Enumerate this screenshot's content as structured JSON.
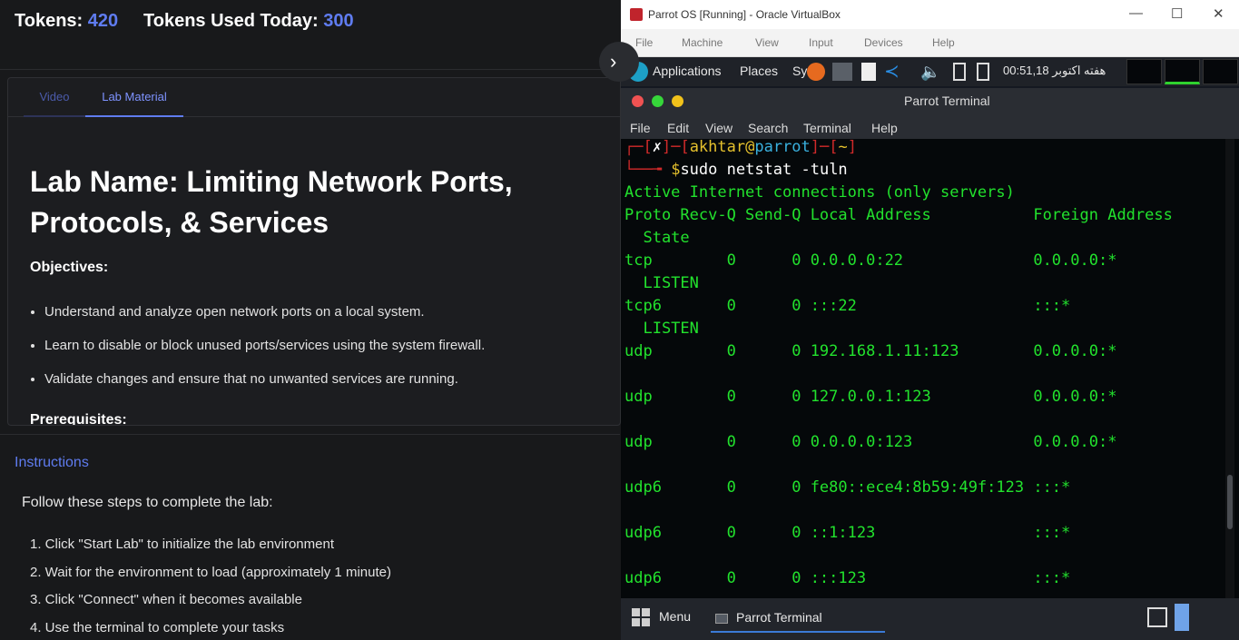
{
  "lab": {
    "tokens_label": "Tokens:",
    "tokens_value": "420",
    "tokens_today_label": "Tokens Used Today:",
    "tokens_today_value": "300",
    "tabs": [
      {
        "label": "Video"
      },
      {
        "label": "Lab Material"
      }
    ],
    "title": "Lab Name: Limiting Network Ports, Protocols, & Services",
    "objectives_heading": "Objectives:",
    "objectives": [
      "Understand and analyze open network ports on a local system.",
      "Learn to disable or block unused ports/services using the system firewall.",
      "Validate changes and ensure that no unwanted services are running."
    ],
    "prerequisites_heading": "Prerequisites:",
    "instructions_heading": "Instructions",
    "follow_text": "Follow these steps to complete the lab:",
    "steps": [
      "1. Click \"Start Lab\" to initialize the lab environment",
      "2. Wait for the environment to load (approximately 1 minute)",
      "3. Click \"Connect\" when it becomes available",
      "4. Use the terminal to complete your tasks"
    ]
  },
  "vbox": {
    "title": "Parrot OS [Running] - Oracle VirtualBox",
    "menu": [
      {
        "label": "File"
      },
      {
        "label": "Machine"
      },
      {
        "label": "View"
      },
      {
        "label": "Input"
      },
      {
        "label": "Devices"
      },
      {
        "label": "Help"
      }
    ]
  },
  "guest": {
    "panel": {
      "applications": "Applications",
      "places": "Places",
      "system": "Sy",
      "clock": "00:51,18 هفته اکتوبر"
    },
    "terminal": {
      "title": "Parrot Terminal",
      "menu": [
        {
          "label": "File"
        },
        {
          "label": "Edit"
        },
        {
          "label": "View"
        },
        {
          "label": "Search"
        },
        {
          "label": "Terminal"
        },
        {
          "label": "Help"
        }
      ],
      "prompt_user": "akhtar",
      "prompt_host": "parrot",
      "prompt_dir": "~",
      "command": "sudo netstat -tuln",
      "lines": [
        "Active Internet connections (only servers)",
        "Proto Recv-Q Send-Q Local Address           Foreign Address",
        "  State",
        "tcp        0      0 0.0.0.0:22              0.0.0.0:*",
        "  LISTEN",
        "tcp6       0      0 :::22                   :::*",
        "  LISTEN",
        "udp        0      0 192.168.1.11:123        0.0.0.0:*",
        "",
        "udp        0      0 127.0.0.1:123           0.0.0.0:*",
        "",
        "udp        0      0 0.0.0.0:123             0.0.0.0:*",
        "",
        "udp6       0      0 fe80::ece4:8b59:49f:123 :::*",
        "",
        "udp6       0      0 ::1:123                 :::*",
        "",
        "udp6       0      0 :::123                  :::*"
      ]
    },
    "taskbar": {
      "menu": "Menu",
      "task": "Parrot Terminal"
    }
  }
}
